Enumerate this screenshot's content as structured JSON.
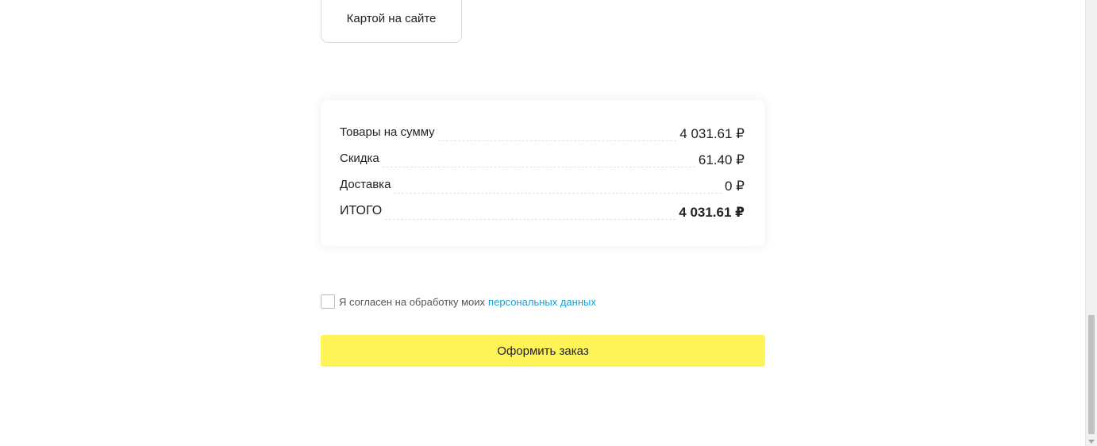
{
  "payment": {
    "card_option_label": "Картой на сайте"
  },
  "summary": {
    "rows": [
      {
        "label": "Товары на сумму",
        "value": "4 031.61 ₽"
      },
      {
        "label": "Скидка",
        "value": "61.40 ₽"
      },
      {
        "label": "Доставка",
        "value": "0 ₽"
      },
      {
        "label": "ИТОГО",
        "value": "4 031.61 ₽"
      }
    ]
  },
  "consent": {
    "text": "Я согласен на обработку моих",
    "link_text": "персональных данных",
    "checked": false
  },
  "order": {
    "button_label": "Оформить заказ"
  },
  "colors": {
    "accent_button": "#fff35a",
    "link": "#1a9fd6"
  }
}
